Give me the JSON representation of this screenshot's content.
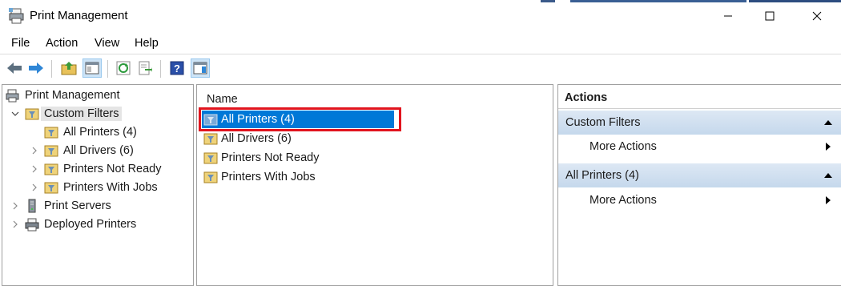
{
  "window": {
    "title": "Print Management",
    "controls": {
      "minimize": "minimize-icon",
      "maximize": "maximize-icon",
      "close": "close-icon"
    }
  },
  "menu": [
    "File",
    "Action",
    "View",
    "Help"
  ],
  "toolbar": {
    "buttons": [
      "back-icon",
      "forward-icon",
      "up-folder-icon",
      "show-hide-tree-icon",
      "refresh-icon",
      "export-icon",
      "help-icon",
      "show-hide-actions-icon"
    ]
  },
  "tree": {
    "root": "Print Management",
    "custom_filters": "Custom Filters",
    "filters": [
      "All Printers (4)",
      "All Drivers (6)",
      "Printers Not Ready",
      "Printers With Jobs"
    ],
    "print_servers": "Print Servers",
    "deployed_printers": "Deployed Printers"
  },
  "list": {
    "column_name": "Name",
    "rows": [
      "All Printers (4)",
      "All Drivers (6)",
      "Printers Not Ready",
      "Printers With Jobs"
    ],
    "selected_index": 0
  },
  "actions": {
    "title": "Actions",
    "sections": [
      {
        "title": "Custom Filters",
        "item": "More Actions"
      },
      {
        "title": "All Printers (4)",
        "item": "More Actions"
      }
    ]
  },
  "colors": {
    "selection": "#0078d7",
    "highlight_box": "#e1141e",
    "section_bg": "#c5d8ec"
  }
}
